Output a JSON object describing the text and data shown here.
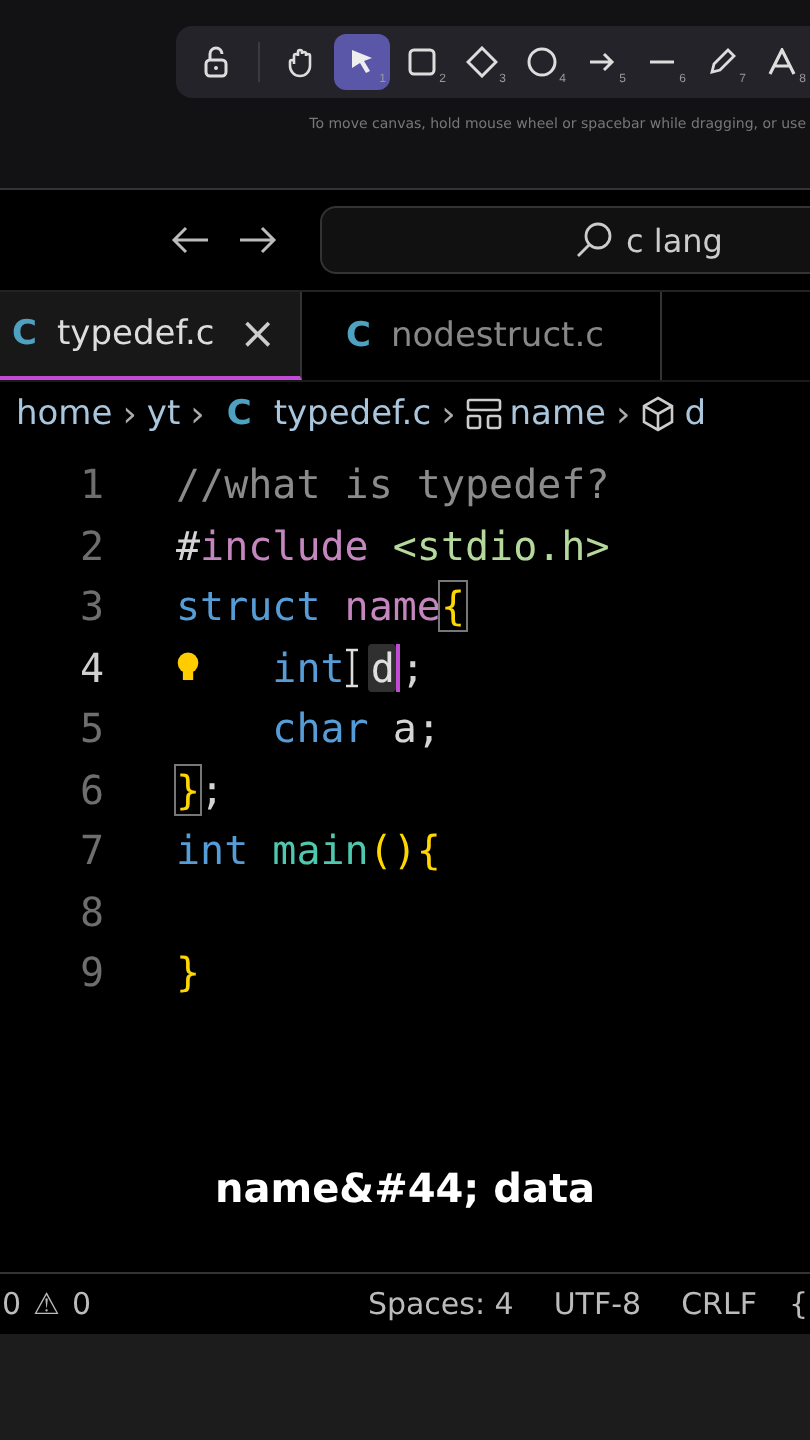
{
  "toolbar": {
    "tools": [
      {
        "kind": "lock",
        "selected": false
      },
      {
        "kind": "hand",
        "selected": false
      },
      {
        "kind": "pointer",
        "shortcut": "1",
        "selected": true
      },
      {
        "kind": "rectangle",
        "shortcut": "2",
        "selected": false
      },
      {
        "kind": "diamond",
        "shortcut": "3",
        "selected": false
      },
      {
        "kind": "circle",
        "shortcut": "4",
        "selected": false
      },
      {
        "kind": "arrow",
        "shortcut": "5",
        "selected": false
      },
      {
        "kind": "line",
        "shortcut": "6",
        "selected": false
      },
      {
        "kind": "pencil",
        "shortcut": "7",
        "selected": false
      },
      {
        "kind": "text",
        "shortcut": "8",
        "selected": false
      }
    ],
    "hint": "To move canvas, hold mouse wheel or spacebar while dragging, or use"
  },
  "title_bar": {
    "search": "c lang"
  },
  "tabs": [
    {
      "icon": "C",
      "label": "typedef.c",
      "close": "×",
      "selected": true
    },
    {
      "icon": "C",
      "label": "nodestruct.c",
      "selected": false
    }
  ],
  "breadcrumbs": [
    {
      "kind": "text",
      "text": "home"
    },
    {
      "kind": "sep",
      "text": "›"
    },
    {
      "kind": "text",
      "text": "yt"
    },
    {
      "kind": "sep",
      "text": "›"
    },
    {
      "kind": "c",
      "text": "C"
    },
    {
      "kind": "text",
      "text": "typedef.c"
    },
    {
      "kind": "sep",
      "text": "›"
    },
    {
      "kind": "struct",
      "text": "name"
    },
    {
      "kind": "sep",
      "text": "›"
    },
    {
      "kind": "field",
      "text": "d"
    }
  ],
  "editor": {
    "lines": [
      {
        "number": "1",
        "current": false,
        "tokens": [
          {
            "kind": "plain",
            "text": "//what is typedef?",
            "color": "#8b8b8b"
          }
        ]
      },
      {
        "number": "2",
        "current": false,
        "tokens": [
          {
            "kind": "plain",
            "text": "#",
            "color": "#d4d4d4"
          },
          {
            "kind": "plain",
            "text": "include ",
            "color": "#c586c0"
          },
          {
            "kind": "plain",
            "text": "<stdio.h>",
            "color": "#b5d99c"
          }
        ]
      },
      {
        "number": "3",
        "current": false,
        "tokens": [
          {
            "kind": "plain",
            "text": "struct ",
            "color": "#569cd6"
          },
          {
            "kind": "plain",
            "text": "name",
            "color": "#c586c0"
          },
          {
            "kind": "bracket",
            "text": "{",
            "color": "#ffd700"
          }
        ]
      },
      {
        "number": "4",
        "current": true,
        "tokens": [
          {
            "kind": "lightbulb"
          },
          {
            "kind": "plain",
            "text": "   int",
            "color": "#569cd6"
          },
          {
            "kind": "ibeam"
          },
          {
            "kind": "highlight",
            "text": "d"
          },
          {
            "kind": "caret"
          },
          {
            "kind": "plain",
            "text": ";",
            "color": "#d4d4d4"
          }
        ]
      },
      {
        "number": "5",
        "current": false,
        "tokens": [
          {
            "kind": "plain",
            "text": "    char ",
            "color": "#569cd6"
          },
          {
            "kind": "plain",
            "text": "a;",
            "color": "#d4d4d4"
          }
        ]
      },
      {
        "number": "6",
        "current": false,
        "tokens": [
          {
            "kind": "bracket",
            "text": "}",
            "color": "#ffd700"
          },
          {
            "kind": "plain",
            "text": ";",
            "color": "#d4d4d4"
          }
        ]
      },
      {
        "number": "7",
        "current": false,
        "tokens": [
          {
            "kind": "plain",
            "text": "int ",
            "color": "#569cd6"
          },
          {
            "kind": "plain",
            "text": "main",
            "color": "#4ec9b0"
          },
          {
            "kind": "plain",
            "text": "(){",
            "color": "#ffd700"
          }
        ]
      },
      {
        "number": "8",
        "current": false
      },
      {
        "number": "9",
        "current": false,
        "tokens": [
          {
            "kind": "plain",
            "text": "}",
            "color": "#ffd700"
          }
        ]
      }
    ]
  },
  "caption": "name&#44; data",
  "status_bar": {
    "errors": "0",
    "warning_icon": "⚠",
    "warnings": "0",
    "items": [
      "Spaces: 4",
      "UTF-8",
      "CRLF",
      "{"
    ]
  }
}
